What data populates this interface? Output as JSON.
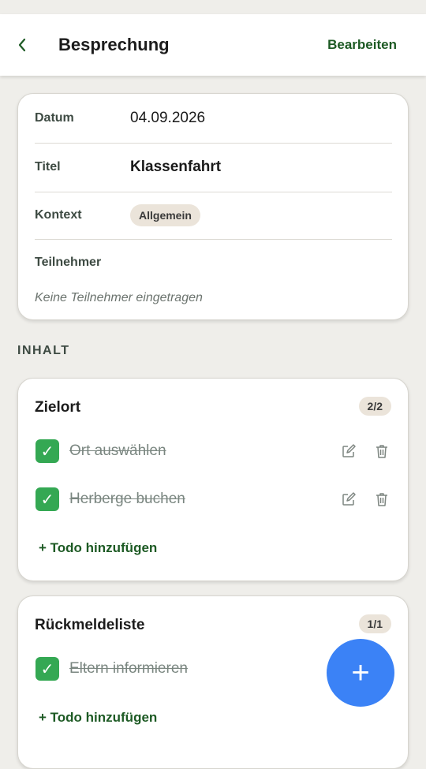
{
  "header": {
    "back_icon": "chevron-left-icon",
    "title": "Besprechung",
    "edit_label": "Bearbeiten"
  },
  "meta": {
    "date_label": "Datum",
    "date_value": "04.09.2026",
    "title_label": "Titel",
    "title_value": "Klassenfahrt",
    "context_label": "Kontext",
    "context_value": "Allgemein",
    "participants_label": "Teilnehmer",
    "participants_empty": "Keine Teilnehmer eingetragen"
  },
  "section": {
    "title": "INHALT"
  },
  "groups": [
    {
      "title": "Zielort",
      "count": "2/2",
      "todos": [
        {
          "text": "Ort auswählen",
          "done": true
        },
        {
          "text": "Herberge buchen",
          "done": true
        }
      ],
      "add_label": "+ Todo hinzufügen"
    },
    {
      "title": "Rückmeldeliste",
      "count": "1/1",
      "todos": [
        {
          "text": "Eltern informieren",
          "done": true
        }
      ],
      "add_label": "+ Todo hinzufügen"
    }
  ],
  "fab": {
    "icon": "plus-icon",
    "label": "+"
  },
  "colors": {
    "accent_green": "#1d5a24",
    "check_green": "#34a853",
    "chip_bg": "#ebe4da",
    "fab_blue": "#3b82f6",
    "background": "#efeeea"
  }
}
